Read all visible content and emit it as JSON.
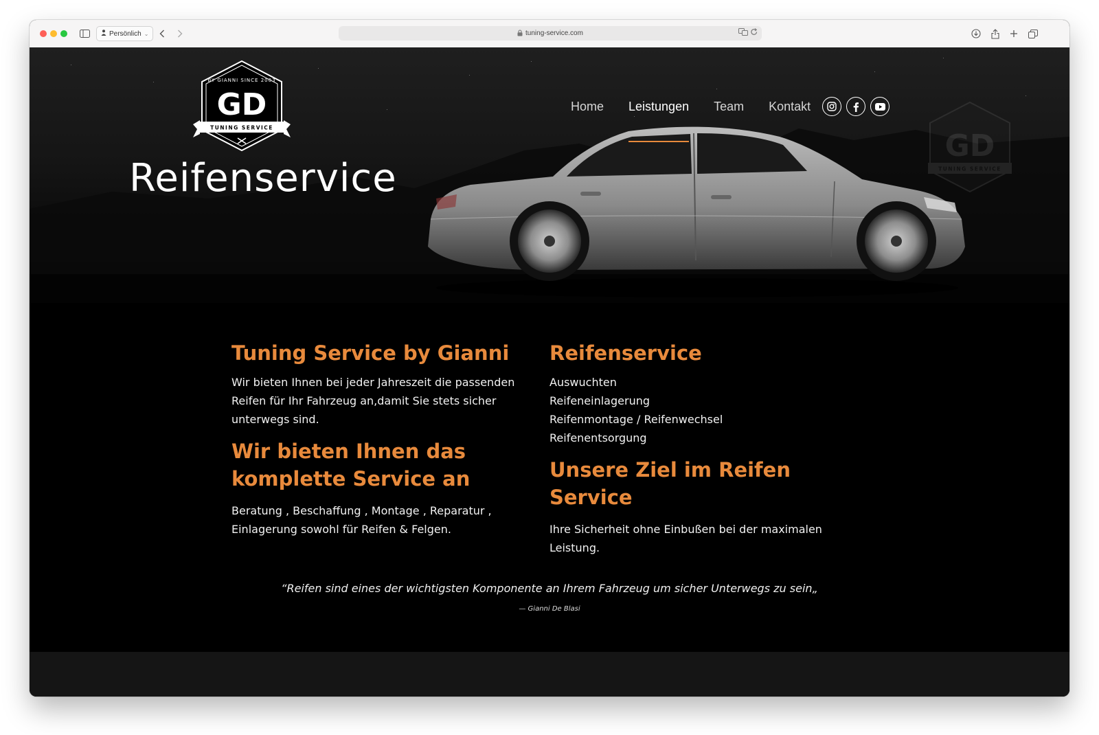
{
  "browser": {
    "profile_label": "Persönlich",
    "url": "tuning-service.com"
  },
  "logo": {
    "arc_text": "BY GIANNI SINCE 2003",
    "monogram": "GD",
    "banner_text": "TUNING SERVICE"
  },
  "hero": {
    "title": "Reifenservice"
  },
  "nav": {
    "items": [
      {
        "label": "Home"
      },
      {
        "label": "Leistungen"
      },
      {
        "label": "Team"
      },
      {
        "label": "Kontakt"
      }
    ],
    "active": "Leistungen"
  },
  "social": [
    "instagram-icon",
    "facebook-icon",
    "youtube-icon"
  ],
  "left_column": {
    "heading1": "Tuning Service by Gianni",
    "text1": "Wir bieten Ihnen bei jeder Jahreszeit die passenden Reifen für Ihr Fahrzeug an,damit Sie stets sicher unterwegs sind.",
    "heading2": "Wir bieten Ihnen das komplette Service an",
    "text2": "Beratung , Beschaffung , Montage , Reparatur , Einlagerung sowohl für Reifen & Felgen."
  },
  "right_column": {
    "heading1": "Reifenservice",
    "services": [
      "Auswuchten",
      "Reifeneinlagerung",
      "Reifenmontage / Reifenwechsel",
      "Reifenentsorgung"
    ],
    "heading2": "Unsere Ziel im Reifen Service",
    "text2": "Ihre Sicherheit ohne Einbußen bei der maximalen Leistung."
  },
  "quote": {
    "text": "“Reifen sind eines der wichtigsten Komponente an Ihrem Fahrzeug um sicher Unterwegs zu sein„",
    "author": "— Gianni De Blasi"
  },
  "colors": {
    "accent": "#e88a3c",
    "background": "#000000"
  }
}
